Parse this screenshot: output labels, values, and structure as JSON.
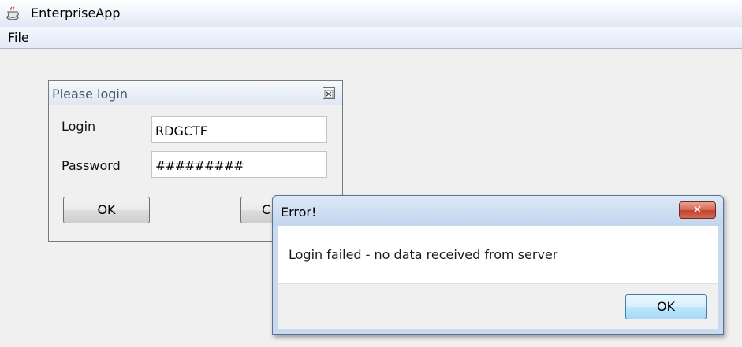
{
  "app": {
    "title": "EnterpriseApp",
    "icon": "java-coffee-icon"
  },
  "menu": {
    "items": [
      {
        "label": "File"
      }
    ]
  },
  "login_dialog": {
    "title": "Please login",
    "close_icon": "close-icon",
    "login_label": "Login",
    "login_value": "RDGCTF",
    "password_label": "Password",
    "password_value": "#########",
    "ok_label": "OK",
    "cancel_label_visible": "C"
  },
  "error_dialog": {
    "title": "Error!",
    "close_label": "✕",
    "message": "Login failed - no data received from server",
    "ok_label": "OK"
  },
  "colors": {
    "close_button_red": "#c0412a",
    "default_button_blue": "#3c7fb1"
  }
}
